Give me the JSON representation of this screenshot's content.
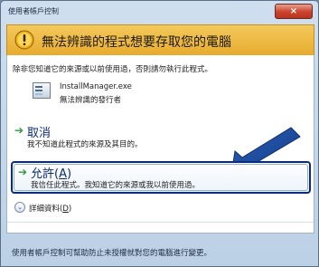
{
  "window": {
    "title": "使用者帳戶控制",
    "close_glyph": "×"
  },
  "banner": {
    "icon": "shield-warning-icon",
    "title": "無法辨識的程式想要存取您的電腦"
  },
  "intro_text": "除非您知道它的來源或以前使用過，否則請勿執行此程式。",
  "app": {
    "icon": "application-icon",
    "name": "InstallManager.exe",
    "publisher": "無法辨識的發行者"
  },
  "options": {
    "cancel": {
      "title": "取消",
      "description": "我不知道此程式的來源及其目的。"
    },
    "allow": {
      "title_prefix": "允許(",
      "title_key": "A",
      "title_suffix": ")",
      "description": "我信任此程式。我知道它的來源或我以前使用過。"
    }
  },
  "details": {
    "label_prefix": "詳細資料(",
    "label_key": "D",
    "label_suffix": ")"
  },
  "footer_text": "使用者帳戶控制可幫助防止未授權就對您的電腦進行變更。",
  "colors": {
    "banner": "#e7ab2e",
    "option_title": "#0e2c73",
    "arrow": "#2f9b3a"
  }
}
